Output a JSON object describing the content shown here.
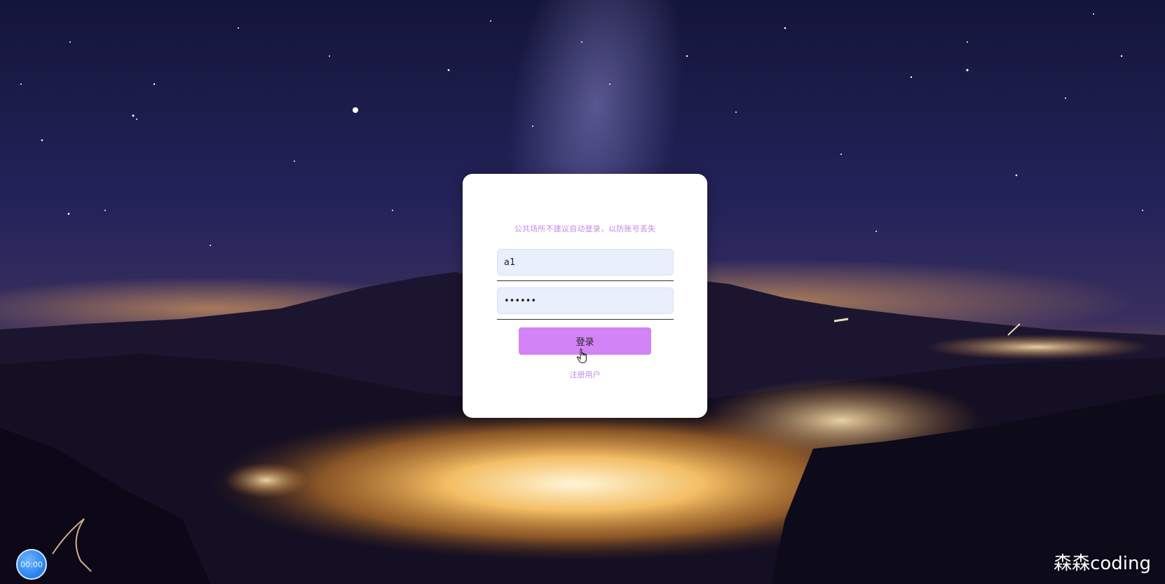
{
  "login": {
    "notice": "公共场所不建议自动登录，以防账号丢失",
    "username_value": "a1",
    "password_value": "123456",
    "login_label": "登录",
    "register_label": "注册用户"
  },
  "overlay": {
    "timer": "00:00",
    "watermark": "森森coding"
  },
  "colors": {
    "accent": "#d283f6",
    "notice_text": "#c58be0",
    "input_bg": "#e8f0fe"
  }
}
